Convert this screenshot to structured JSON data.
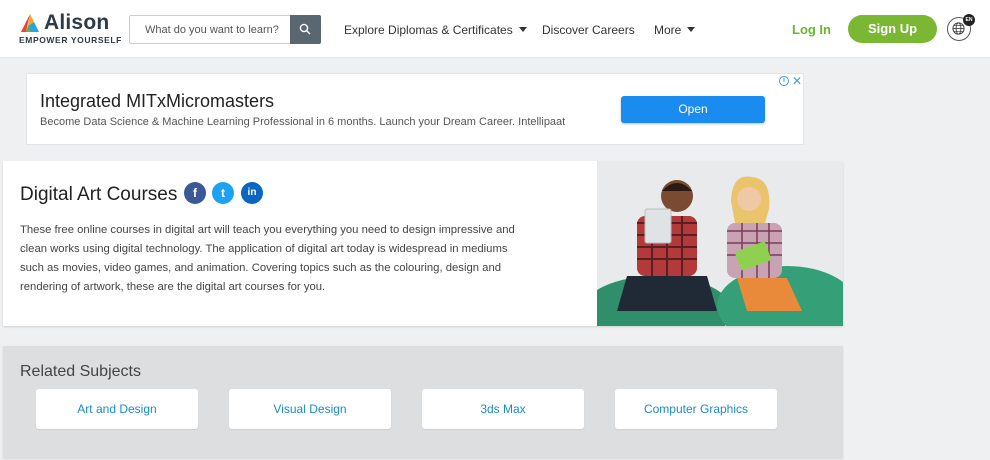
{
  "brand": {
    "name": "Alison",
    "tagline": "EMPOWER YOURSELF"
  },
  "search": {
    "placeholder": "What do you want to learn?"
  },
  "nav": {
    "diplomas": "Explore Diplomas & Certificates",
    "careers": "Discover Careers",
    "more": "More"
  },
  "auth": {
    "login": "Log In",
    "signup": "Sign Up"
  },
  "locale": {
    "badge": "EN"
  },
  "ad": {
    "title": "Integrated MITxMicromasters",
    "subtitle": "Become Data Science & Machine Learning Professional in 6 months. Launch your Dream Career. Intellipaat",
    "button": "Open",
    "info": "i",
    "close": "✕"
  },
  "hero": {
    "title": "Digital Art Courses",
    "social": {
      "facebook": "f",
      "twitter": "t",
      "linkedin": "in"
    },
    "description": "These free online courses in digital art will teach you everything you need to design impressive and clean works using digital technology. The application of digital art today is widespread in mediums such as movies, video games, and animation. Covering topics such as the colouring, design and rendering of artwork, these are the digital art courses for you."
  },
  "related": {
    "title": "Related Subjects",
    "subjects": [
      "Art and Design",
      "Visual Design",
      "3ds Max",
      "Computer Graphics"
    ]
  },
  "colors": {
    "accent_green": "#7ab833",
    "link_blue": "#1a8bc8",
    "ad_button": "#1a8cf0"
  }
}
